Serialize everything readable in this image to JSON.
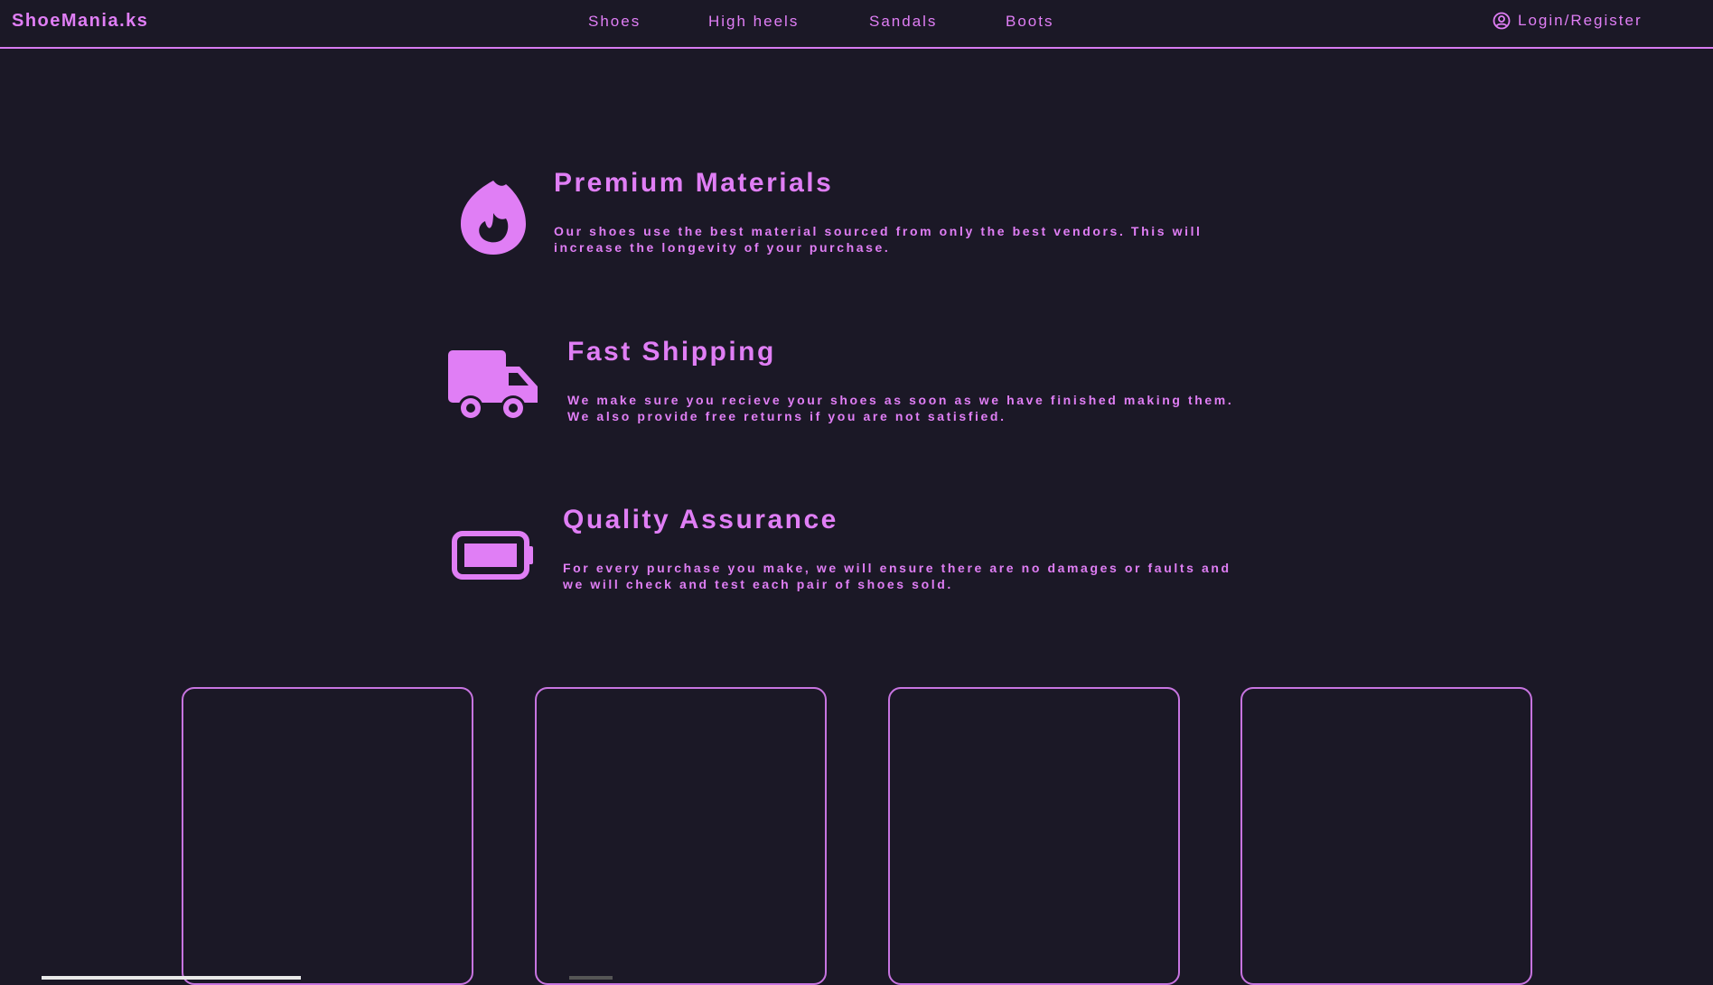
{
  "header": {
    "brand": "ShoeMania.ks",
    "nav": [
      {
        "label": "Shoes"
      },
      {
        "label": "High heels"
      },
      {
        "label": "Sandals"
      },
      {
        "label": "Boots"
      }
    ],
    "login_label": "Login/Register"
  },
  "features": [
    {
      "icon": "fire-icon",
      "title": "Premium Materials",
      "description": "Our shoes use the best material sourced from only the best vendors. This will increase the longevity of your purchase."
    },
    {
      "icon": "truck-icon",
      "title": "Fast Shipping",
      "description": "We make sure you recieve your shoes as soon as we have finished making them. We also provide free returns if you are not satisfied."
    },
    {
      "icon": "battery-icon",
      "title": "Quality Assurance",
      "description": "For every purchase you make, we will ensure there are no damages or faults and we will check and test each pair of shoes sold."
    }
  ],
  "colors": {
    "background": "#1b1826",
    "accent": "#e07ef5",
    "border": "#c774e0"
  }
}
